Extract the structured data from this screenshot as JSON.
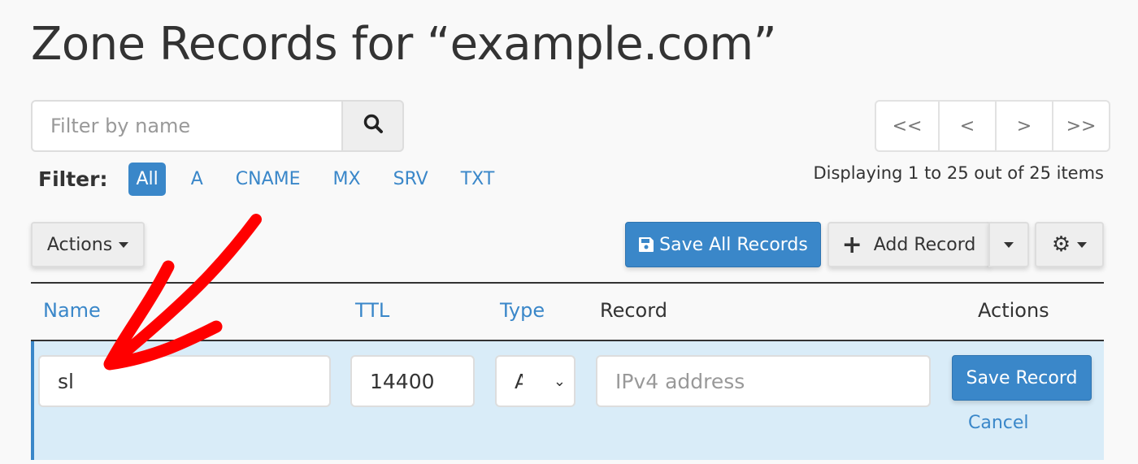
{
  "title": "Zone Records for “example.com”",
  "search": {
    "placeholder": "Filter by name",
    "icon": "search-icon"
  },
  "pager": [
    "<<",
    "<",
    ">",
    ">>"
  ],
  "filter": {
    "label": "Filter:",
    "options": [
      "All",
      "A",
      "CNAME",
      "MX",
      "SRV",
      "TXT"
    ],
    "active": "All"
  },
  "display_text": "Displaying 1 to 25 out of 25 items",
  "toolbar": {
    "actions": "Actions",
    "save_all": "Save All Records",
    "add_record": "Add Record"
  },
  "table": {
    "headers": [
      "Name",
      "TTL",
      "Type",
      "Record",
      "Actions"
    ]
  },
  "edit_row": {
    "name": "sl",
    "ttl": "14400",
    "type": "A",
    "record_placeholder": "IPv4 address",
    "save": "Save Record",
    "cancel": "Cancel"
  },
  "colors": {
    "accent": "#3a87c9",
    "row_bg": "#d9ecf8",
    "annotation": "#ff0000"
  }
}
